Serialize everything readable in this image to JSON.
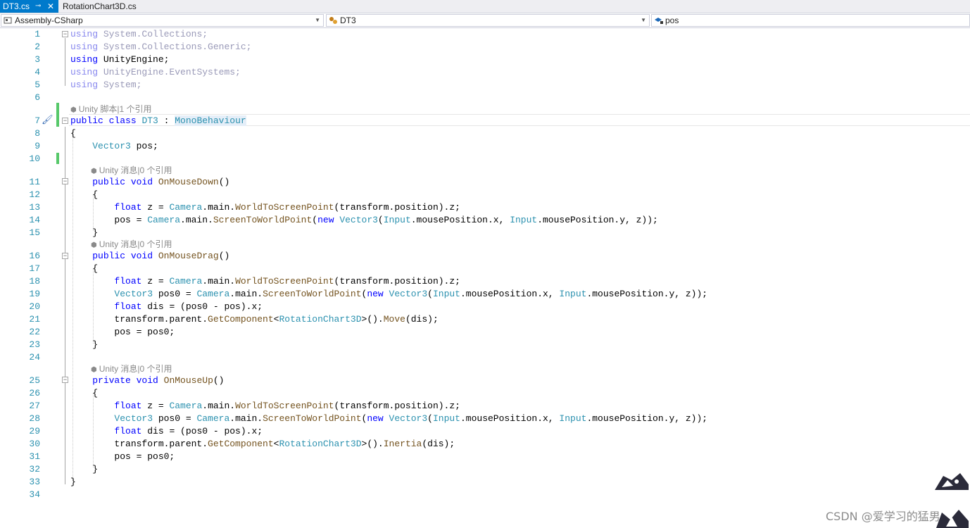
{
  "tabs": [
    {
      "label": "DT3.cs",
      "pin": "⊸",
      "close": "✕"
    },
    {
      "label": "RotationChart3D.cs"
    }
  ],
  "navbar": {
    "project": "Assembly-CSharp",
    "class": "DT3",
    "member": "pos"
  },
  "codelens": [
    {
      "text": "Unity 脚本|1 个引用"
    },
    {
      "text": "Unity 消息|0 个引用"
    },
    {
      "text": "Unity 消息|0 个引用"
    },
    {
      "text": "Unity 消息|0 个引用"
    }
  ],
  "code_lines": [
    {
      "n": "1"
    },
    {
      "n": "2"
    },
    {
      "n": "3"
    },
    {
      "n": "4"
    },
    {
      "n": "5"
    },
    {
      "n": "6"
    },
    {
      "n": "7"
    },
    {
      "n": "8"
    },
    {
      "n": "9"
    },
    {
      "n": "10"
    },
    {
      "n": "11"
    },
    {
      "n": "12"
    },
    {
      "n": "13"
    },
    {
      "n": "14"
    },
    {
      "n": "15"
    },
    {
      "n": "16"
    },
    {
      "n": "17"
    },
    {
      "n": "18"
    },
    {
      "n": "19"
    },
    {
      "n": "20"
    },
    {
      "n": "21"
    },
    {
      "n": "22"
    },
    {
      "n": "23"
    },
    {
      "n": "24"
    },
    {
      "n": "25"
    },
    {
      "n": "26"
    },
    {
      "n": "27"
    },
    {
      "n": "28"
    },
    {
      "n": "29"
    },
    {
      "n": "30"
    },
    {
      "n": "31"
    },
    {
      "n": "32"
    },
    {
      "n": "33"
    },
    {
      "n": "34"
    }
  ],
  "watermark": "CSDN @爱学习的猛男",
  "colors": {
    "accent": "#007acc",
    "keyword": "#0000ff",
    "type": "#2b91af",
    "method": "#74531f",
    "line_number": "#2b91af",
    "changed": "#57c86a"
  },
  "icons": [
    "solution-icon",
    "class-icon",
    "field-icon",
    "brush-icon",
    "unity-cube-icon"
  ]
}
